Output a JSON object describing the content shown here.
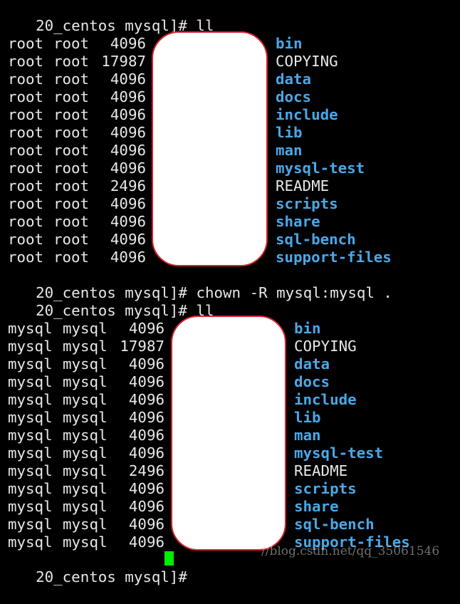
{
  "terminal": {
    "colors": {
      "background": "#000000",
      "text": "#e8e8e8",
      "directory": "#4aa8e8",
      "cursor": "#00ee00",
      "redaction_border": "#d8202a"
    },
    "prompt": "20_centos mysql]# ",
    "commands": [
      {
        "prompt": "20_centos mysql]# ",
        "command": "ll"
      },
      {
        "prompt": "20_centos mysql]# ",
        "command": "chown -R mysql:mysql ."
      },
      {
        "prompt": "20_centos mysql]# ",
        "command": "ll"
      },
      {
        "prompt": "20_centos mysql]# ",
        "command": ""
      }
    ],
    "listing_before": [
      {
        "owner": "root",
        "group": "root",
        "size": "4096",
        "name": "bin",
        "type": "dir"
      },
      {
        "owner": "root",
        "group": "root",
        "size": "17987",
        "name": "COPYING",
        "type": "file"
      },
      {
        "owner": "root",
        "group": "root",
        "size": "4096",
        "name": "data",
        "type": "dir"
      },
      {
        "owner": "root",
        "group": "root",
        "size": "4096",
        "name": "docs",
        "type": "dir"
      },
      {
        "owner": "root",
        "group": "root",
        "size": "4096",
        "name": "include",
        "type": "dir"
      },
      {
        "owner": "root",
        "group": "root",
        "size": "4096",
        "name": "lib",
        "type": "dir"
      },
      {
        "owner": "root",
        "group": "root",
        "size": "4096",
        "name": "man",
        "type": "dir"
      },
      {
        "owner": "root",
        "group": "root",
        "size": "4096",
        "name": "mysql-test",
        "type": "dir"
      },
      {
        "owner": "root",
        "group": "root",
        "size": "2496",
        "name": "README",
        "type": "file"
      },
      {
        "owner": "root",
        "group": "root",
        "size": "4096",
        "name": "scripts",
        "type": "dir"
      },
      {
        "owner": "root",
        "group": "root",
        "size": "4096",
        "name": "share",
        "type": "dir"
      },
      {
        "owner": "root",
        "group": "root",
        "size": "4096",
        "name": "sql-bench",
        "type": "dir"
      },
      {
        "owner": "root",
        "group": "root",
        "size": "4096",
        "name": "support-files",
        "type": "dir"
      }
    ],
    "listing_after": [
      {
        "owner": "mysql",
        "group": "mysql",
        "size": "4096",
        "name": "bin",
        "type": "dir"
      },
      {
        "owner": "mysql",
        "group": "mysql",
        "size": "17987",
        "name": "COPYING",
        "type": "file"
      },
      {
        "owner": "mysql",
        "group": "mysql",
        "size": "4096",
        "name": "data",
        "type": "dir"
      },
      {
        "owner": "mysql",
        "group": "mysql",
        "size": "4096",
        "name": "docs",
        "type": "dir"
      },
      {
        "owner": "mysql",
        "group": "mysql",
        "size": "4096",
        "name": "include",
        "type": "dir"
      },
      {
        "owner": "mysql",
        "group": "mysql",
        "size": "4096",
        "name": "lib",
        "type": "dir"
      },
      {
        "owner": "mysql",
        "group": "mysql",
        "size": "4096",
        "name": "man",
        "type": "dir"
      },
      {
        "owner": "mysql",
        "group": "mysql",
        "size": "4096",
        "name": "mysql-test",
        "type": "dir"
      },
      {
        "owner": "mysql",
        "group": "mysql",
        "size": "2496",
        "name": "README",
        "type": "file"
      },
      {
        "owner": "mysql",
        "group": "mysql",
        "size": "4096",
        "name": "scripts",
        "type": "dir"
      },
      {
        "owner": "mysql",
        "group": "mysql",
        "size": "4096",
        "name": "share",
        "type": "dir"
      },
      {
        "owner": "mysql",
        "group": "mysql",
        "size": "4096",
        "name": "sql-bench",
        "type": "dir"
      },
      {
        "owner": "mysql",
        "group": "mysql",
        "size": "4096",
        "name": "support-files",
        "type": "dir"
      }
    ],
    "watermark": "//blog.csdn.net/qq_35061546"
  }
}
